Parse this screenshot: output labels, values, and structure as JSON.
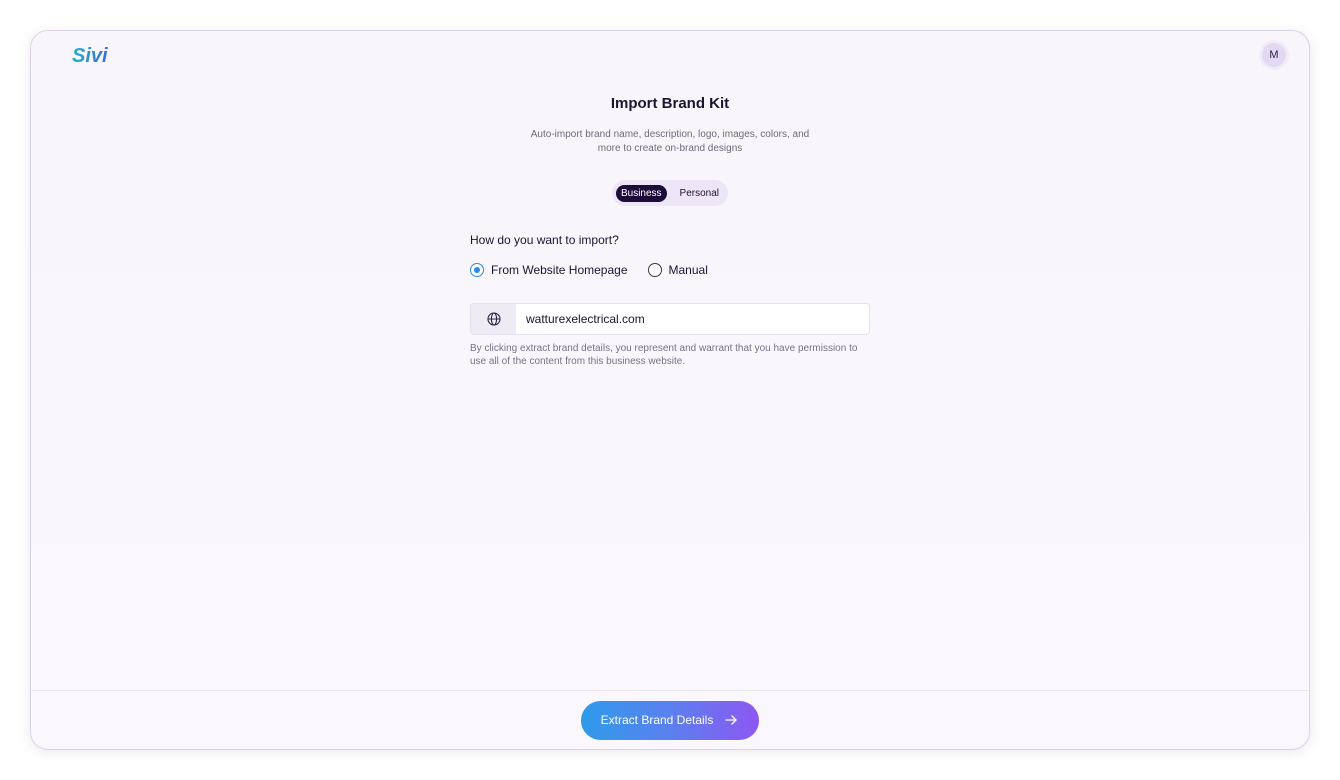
{
  "app": {
    "logo_text": "Sivi",
    "avatar_initial": "M"
  },
  "page": {
    "title": "Import Brand Kit",
    "subtitle": "Auto-import brand name, description, logo, images, colors, and more to create on-brand designs"
  },
  "account_type_toggle": {
    "options": [
      {
        "label": "Business",
        "selected": true
      },
      {
        "label": "Personal",
        "selected": false
      }
    ]
  },
  "import_method": {
    "question": "How do you want to import?",
    "options": [
      {
        "label": "From Website Homepage",
        "selected": true
      },
      {
        "label": "Manual",
        "selected": false
      }
    ]
  },
  "website_input": {
    "value": "watturexelectrical.com",
    "icon": "globe-icon"
  },
  "disclaimer": "By clicking extract brand details, you represent and warrant that you have permission to use all of the content from this business website.",
  "footer": {
    "primary_button_label": "Extract Brand Details",
    "primary_button_icon": "arrow-right-icon"
  },
  "colors": {
    "brand_dark": "#1d0c3b",
    "radio_accent": "#2b8ae6",
    "button_gradient_start": "#2e9bea",
    "button_gradient_end": "#8d57f2",
    "card_background": "#f9f7fc"
  }
}
